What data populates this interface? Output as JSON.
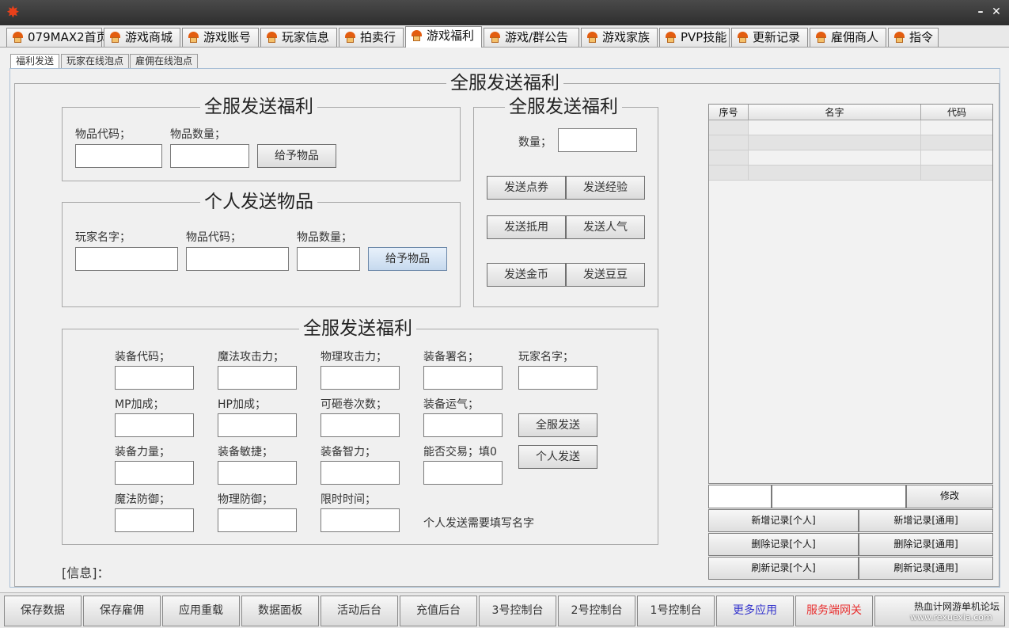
{
  "window": {
    "minimize_glyph": "–",
    "close_glyph": "✕"
  },
  "tabs": [
    {
      "label": "079MAX2首页"
    },
    {
      "label": "游戏商城"
    },
    {
      "label": "游戏账号"
    },
    {
      "label": "玩家信息"
    },
    {
      "label": "拍卖行"
    },
    {
      "label": "游戏福利"
    },
    {
      "label": "游戏/群公告"
    },
    {
      "label": "游戏家族"
    },
    {
      "label": "PVP技能"
    },
    {
      "label": "更新记录"
    },
    {
      "label": "雇佣商人"
    },
    {
      "label": "指令"
    }
  ],
  "subtabs": [
    {
      "label": "福利发送"
    },
    {
      "label": "玩家在线泡点"
    },
    {
      "label": "雇佣在线泡点"
    }
  ],
  "main": {
    "title": "全服发送福利",
    "info_label": "[信息]："
  },
  "server_item": {
    "legend": "全服发送福利",
    "item_code_label": "物品代码；",
    "item_qty_label": "物品数量；",
    "give_button": "给予物品"
  },
  "personal_item": {
    "legend": "个人发送物品",
    "player_name_label": "玩家名字；",
    "item_code_label": "物品代码；",
    "item_qty_label": "物品数量；",
    "give_button": "给予物品"
  },
  "currency": {
    "legend": "全服发送福利",
    "qty_label": "数量；",
    "buttons": {
      "points": "发送点券",
      "exp": "发送经验",
      "mpoints": "发送抵用",
      "fame": "发送人气",
      "gold": "发送金币",
      "beans": "发送豆豆"
    }
  },
  "equipment": {
    "legend": "全服发送福利",
    "fields": {
      "equip_code": "装备代码；",
      "magic_atk": "魔法攻击力；",
      "phys_atk": "物理攻击力；",
      "equip_sign": "装备署名；",
      "player_name": "玩家名字；",
      "mp_bonus": "MP加成；",
      "hp_bonus": "HP加成；",
      "scroll_count": "可砸卷次数；",
      "equip_luck": "装备运气；",
      "equip_str": "装备力量；",
      "equip_dex": "装备敏捷；",
      "equip_int": "装备智力；",
      "tradable": "能否交易；填0",
      "magic_def": "魔法防御；",
      "phys_def": "物理防御；",
      "time_limit": "限时时间；"
    },
    "send_all_button": "全服发送",
    "send_personal_button": "个人发送",
    "hint": "个人发送需要填写名字"
  },
  "records": {
    "columns": [
      "序号",
      "名字",
      "代码"
    ],
    "modify_button": "修改",
    "buttons": {
      "add_personal": "新增记录[个人]",
      "add_general": "新增记录[通用]",
      "delete_personal": "删除记录[个人]",
      "delete_general": "删除记录[通用]",
      "refresh_personal": "刷新记录[个人]",
      "refresh_general": "刷新记录[通用]"
    }
  },
  "bottom_bar": [
    {
      "label": "保存数据",
      "color": "#333333"
    },
    {
      "label": "保存雇佣",
      "color": "#333333"
    },
    {
      "label": "应用重载",
      "color": "#333333"
    },
    {
      "label": "数据面板",
      "color": "#333333"
    },
    {
      "label": "活动后台",
      "color": "#333333"
    },
    {
      "label": "充值后台",
      "color": "#333333"
    },
    {
      "label": "3号控制台",
      "color": "#333333"
    },
    {
      "label": "2号控制台",
      "color": "#333333"
    },
    {
      "label": "1号控制台",
      "color": "#333333"
    },
    {
      "label": "更多应用",
      "color": "#3333cc"
    },
    {
      "label": "服务端网关",
      "color": "#e83030"
    },
    {
      "label": "",
      "color": "#333333"
    }
  ],
  "watermark": "热血计网游单机论坛",
  "watermark_url": "www.rexuexia.com"
}
